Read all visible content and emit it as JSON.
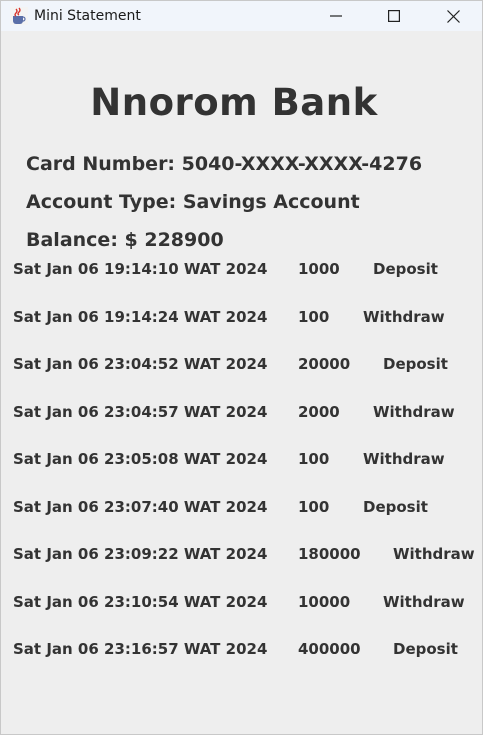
{
  "window": {
    "title": "Mini Statement",
    "icon": "java-cup-icon",
    "controls": [
      "minimize-icon",
      "maximize-icon",
      "close-icon"
    ]
  },
  "bank": {
    "name": "Nnorom Bank"
  },
  "account": {
    "card_line": "Card Number: 5040-XXXX-XXXX-4276",
    "type_line": "Account Type: Savings Account",
    "balance_line": "Balance: $ 228900"
  },
  "transactions": [
    {
      "date": "Sat Jan 06 19:14:10 WAT 2024",
      "amount": "1000",
      "type": "Deposit"
    },
    {
      "date": "Sat Jan 06 19:14:24 WAT 2024",
      "amount": "100",
      "type": "Withdraw"
    },
    {
      "date": "Sat Jan 06 23:04:52 WAT 2024",
      "amount": "20000",
      "type": "Deposit"
    },
    {
      "date": "Sat Jan 06 23:04:57 WAT 2024",
      "amount": "2000",
      "type": "Withdraw"
    },
    {
      "date": "Sat Jan 06 23:05:08 WAT 2024",
      "amount": "100",
      "type": "Withdraw"
    },
    {
      "date": "Sat Jan 06 23:07:40 WAT 2024",
      "amount": "100",
      "type": "Deposit"
    },
    {
      "date": "Sat Jan 06 23:09:22 WAT 2024",
      "amount": "180000",
      "type": "Withdraw"
    },
    {
      "date": "Sat Jan 06 23:10:54 WAT 2024",
      "amount": "10000",
      "type": "Withdraw"
    },
    {
      "date": "Sat Jan 06 23:16:57 WAT 2024",
      "amount": "400000",
      "type": "Deposit"
    }
  ]
}
